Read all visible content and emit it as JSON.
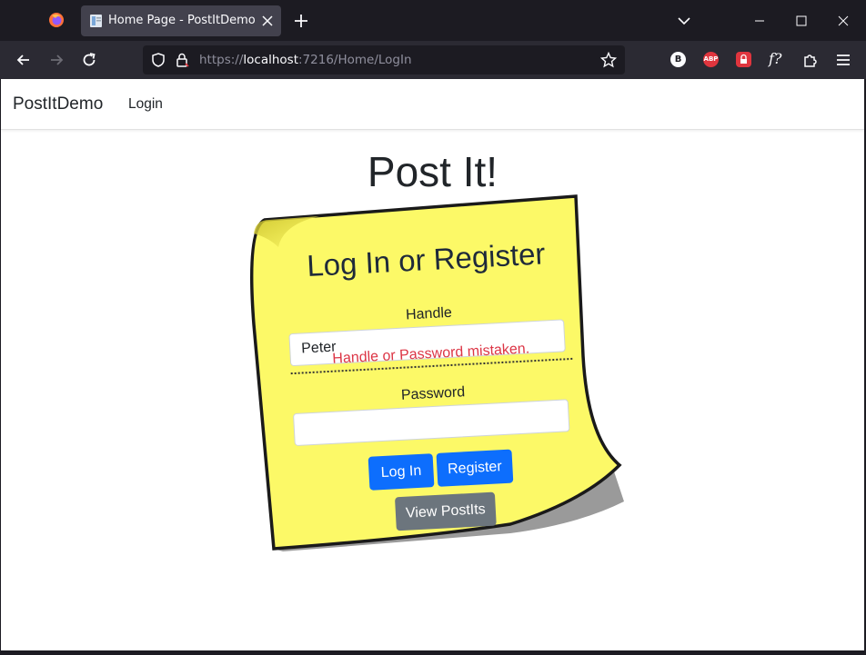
{
  "browser": {
    "tab": {
      "title": "Home Page - PostItDemo"
    },
    "url": {
      "scheme": "https://",
      "host": "localhost",
      "rest": ":7216/Home/LogIn"
    },
    "extensions": {
      "b_label": "B",
      "abp_label": "ABP",
      "f_label": "f?"
    }
  },
  "site": {
    "brand": "PostItDemo",
    "nav_login": "Login",
    "title": "Post It!"
  },
  "form": {
    "heading": "Log In or Register",
    "handle_label": "Handle",
    "handle_value": "Peter",
    "error": "Handle or Password mistaken.",
    "password_label": "Password",
    "password_value": "",
    "login_button": "Log In",
    "register_button": "Register",
    "view_button": "View PostIts"
  },
  "colors": {
    "sticky_yellow": "#fcf967",
    "primary": "#0d6efd",
    "secondary": "#6c757d",
    "error": "#dc3545"
  }
}
